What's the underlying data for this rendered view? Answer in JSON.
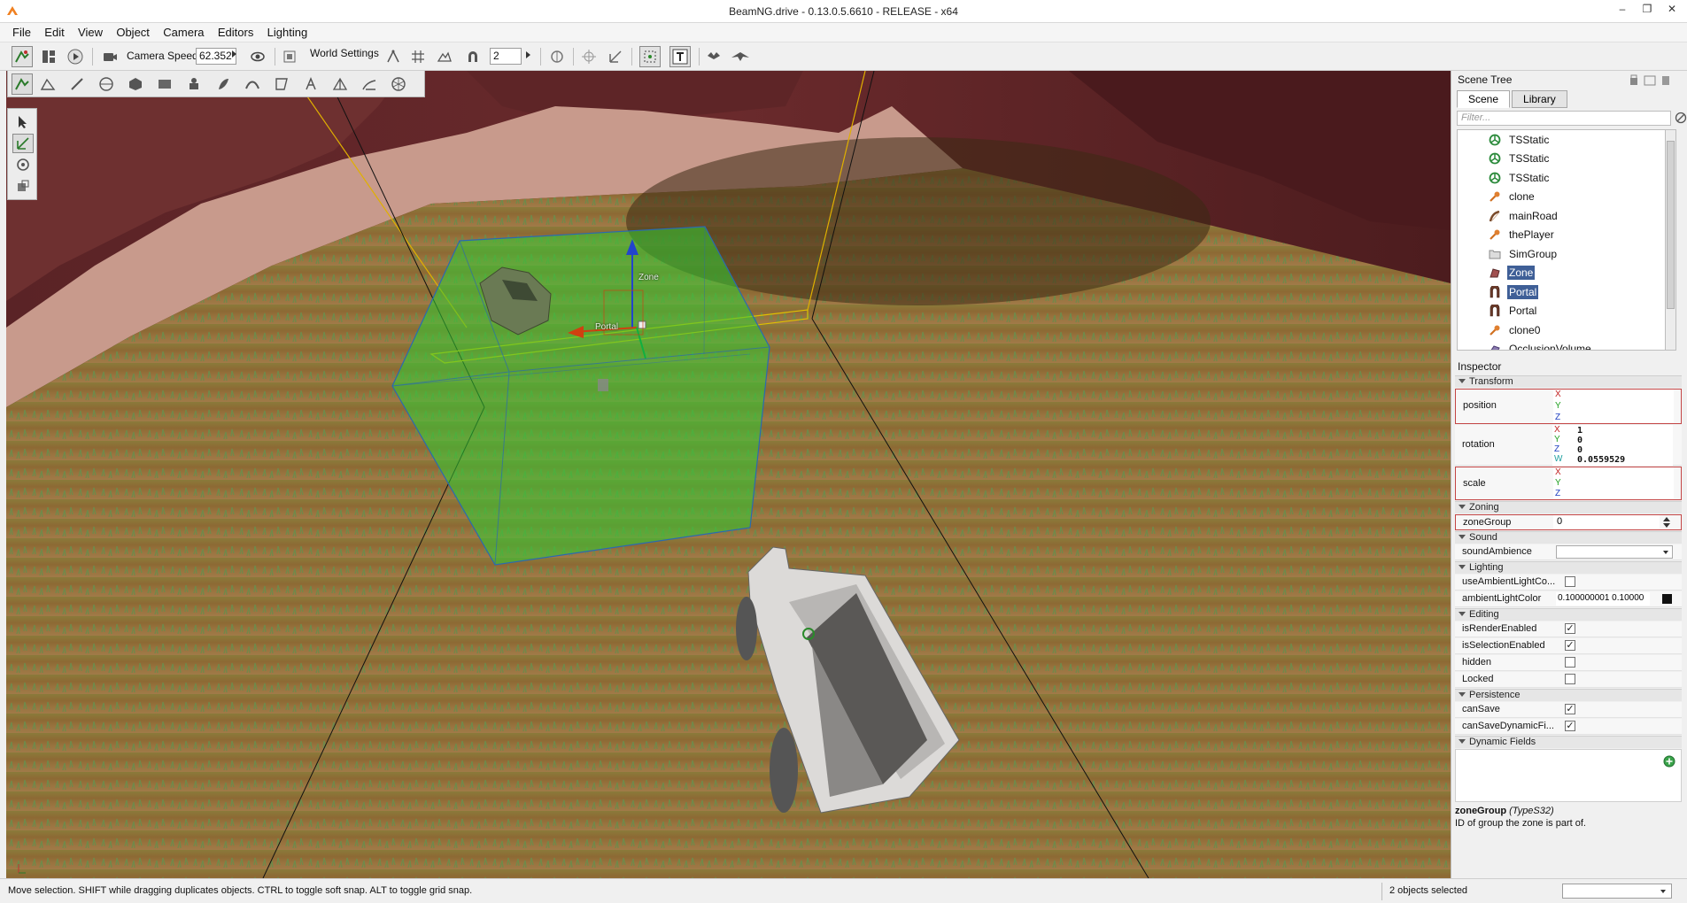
{
  "window": {
    "title": "BeamNG.drive - 0.13.0.5.6610 - RELEASE - x64",
    "min": "–",
    "max": "❐",
    "close": "✕"
  },
  "menu": [
    "File",
    "Edit",
    "View",
    "Object",
    "Camera",
    "Editors",
    "Lighting"
  ],
  "toolbar": {
    "camera_speed_label": "Camera Speed",
    "camera_speed_value": "62.352",
    "world_settings_label": "World Settings",
    "snap_value": "2"
  },
  "viewport_labels": {
    "zone": "Zone",
    "portal": "Portal"
  },
  "scene_tree": {
    "title": "Scene Tree",
    "tabs": [
      "Scene",
      "Library"
    ],
    "filter_placeholder": "Filter...",
    "items": [
      {
        "label": "TSStatic",
        "icon": "tsstatic-icon",
        "selected": false
      },
      {
        "label": "TSStatic",
        "icon": "tsstatic-icon",
        "selected": false
      },
      {
        "label": "TSStatic",
        "icon": "tsstatic-icon",
        "selected": false
      },
      {
        "label": "clone",
        "icon": "clone-icon",
        "selected": false
      },
      {
        "label": "mainRoad",
        "icon": "road-icon",
        "selected": false
      },
      {
        "label": "thePlayer",
        "icon": "player-icon",
        "selected": false
      },
      {
        "label": "SimGroup",
        "icon": "folder-icon",
        "selected": false
      },
      {
        "label": "Zone",
        "icon": "zone-icon",
        "selected": true
      },
      {
        "label": "Portal",
        "icon": "portal-icon",
        "selected": true
      },
      {
        "label": "Portal",
        "icon": "portal-icon",
        "selected": false
      },
      {
        "label": "clone0",
        "icon": "clone-icon",
        "selected": false
      },
      {
        "label": "OcclusionVolume",
        "icon": "occlusion-icon",
        "selected": false
      }
    ]
  },
  "inspector": {
    "title": "Inspector",
    "sections": {
      "transform": "Transform",
      "zoning": "Zoning",
      "sound": "Sound",
      "lighting": "Lighting",
      "editing": "Editing",
      "persistence": "Persistence",
      "dynamic_fields": "Dynamic Fields"
    },
    "axes": {
      "x": "X",
      "y": "Y",
      "z": "Z",
      "w": "W"
    },
    "position_label": "position",
    "rotation_label": "rotation",
    "rotation": {
      "x": "1",
      "y": "0",
      "z": "0",
      "w": "0.0559529"
    },
    "scale_label": "scale",
    "zone_group_label": "zoneGroup",
    "zone_group_value": "0",
    "sound_ambience_label": "soundAmbience",
    "use_ambient_label": "useAmbientLightCo...",
    "ambient_color_label": "ambientLightColor",
    "ambient_color_value": "0.100000001 0.10000",
    "is_render_label": "isRenderEnabled",
    "is_selection_label": "isSelectionEnabled",
    "hidden_label": "hidden",
    "locked_label": "Locked",
    "can_save_label": "canSave",
    "can_save_dynamic_label": "canSaveDynamicFi...",
    "checks": {
      "use_ambient": false,
      "is_render": true,
      "is_selection": true,
      "hidden": false,
      "locked": false,
      "can_save": true,
      "can_save_dynamic": true
    },
    "doc_field": "zoneGroup",
    "doc_type": "(TypeS32)",
    "doc_text": "ID of group the zone is part of."
  },
  "status": {
    "message": "Move selection.  SHIFT while dragging duplicates objects.  CTRL to toggle soft snap.  ALT to toggle grid snap.",
    "selection": "2 objects selected"
  },
  "colors": {
    "accent_selected": "#3f5f97",
    "zone_green": "#33cc33",
    "invalid_border": "#c44646"
  }
}
